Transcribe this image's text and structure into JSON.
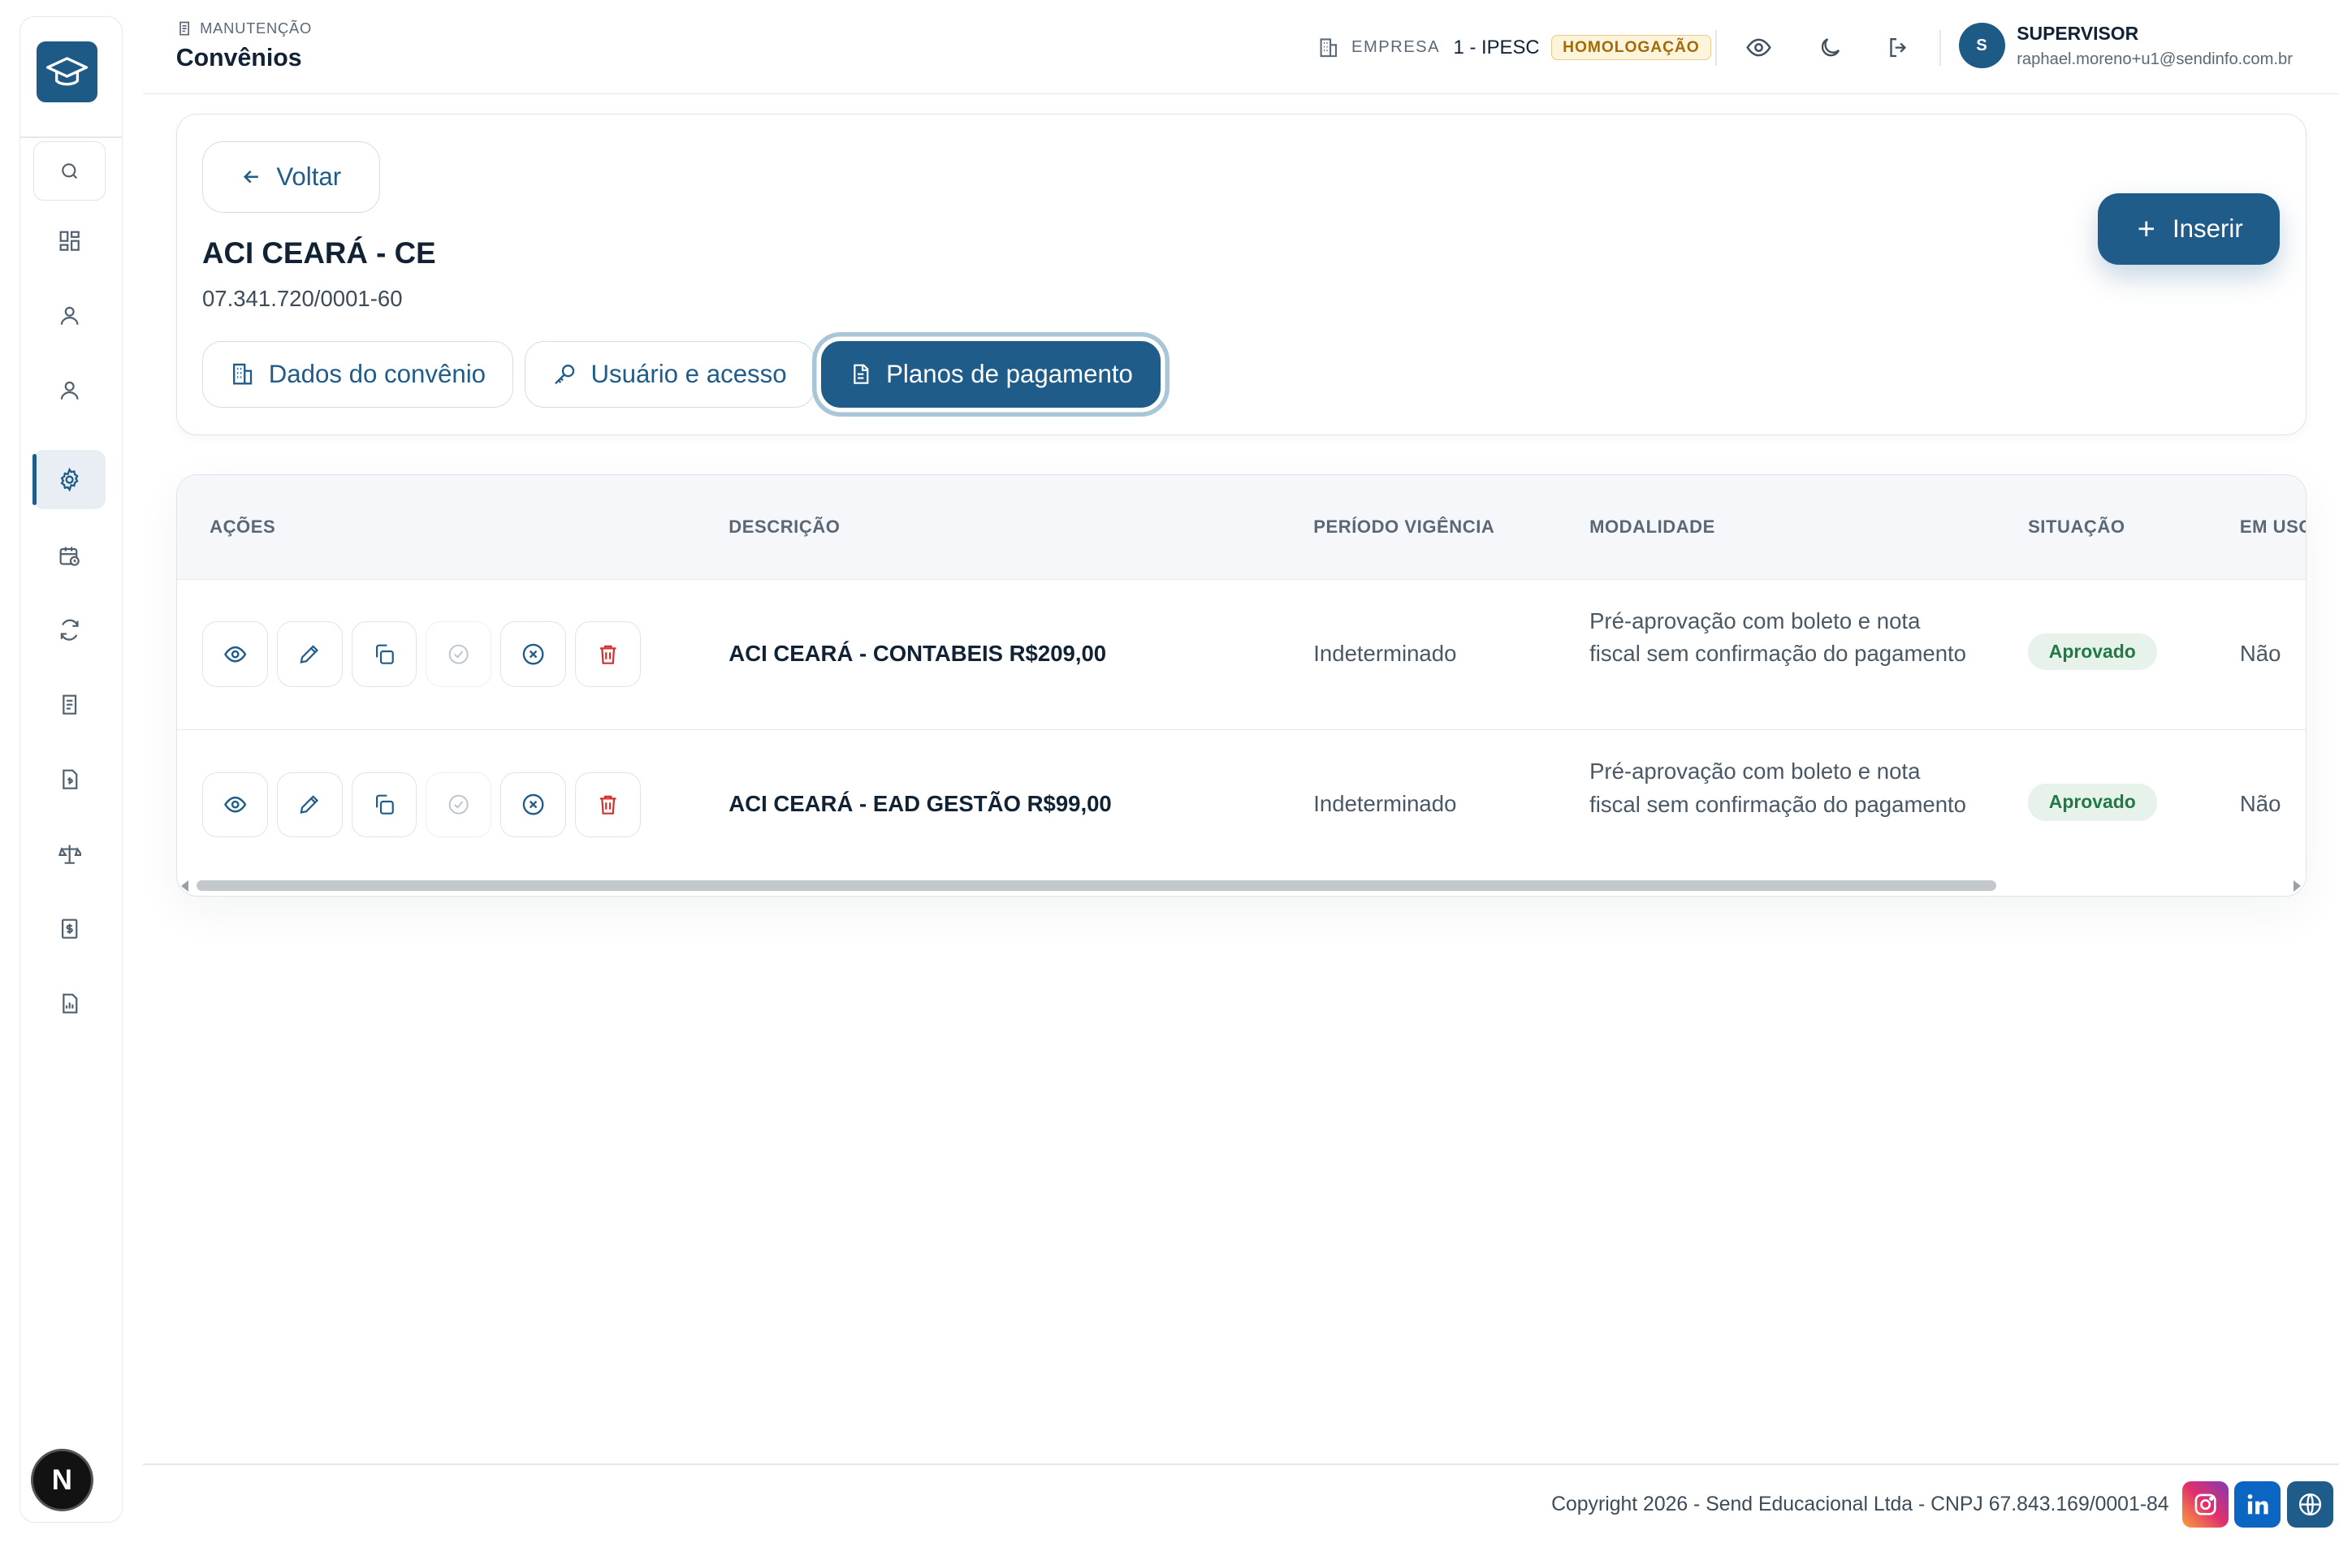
{
  "header": {
    "breadcrumb": "MANUTENÇÃO",
    "title": "Convênios",
    "company_label": "EMPRESA",
    "company_value": "1 - IPESC",
    "env_badge": "HOMOLOGAÇÃO",
    "user_name": "SUPERVISOR",
    "user_email": "raphael.moreno+u1@sendinfo.com.br",
    "avatar_initial": "S"
  },
  "sidebar": {
    "logo_icon": "graduation-cap-icon",
    "items": [
      {
        "icon": "search-icon"
      },
      {
        "icon": "dashboard-icon"
      },
      {
        "icon": "user-icon"
      },
      {
        "icon": "user-icon"
      },
      {
        "icon": "gear-icon",
        "active": true
      },
      {
        "icon": "calendar-clock-icon"
      },
      {
        "icon": "refresh-icon"
      },
      {
        "icon": "document-icon"
      },
      {
        "icon": "file-money-icon"
      },
      {
        "icon": "scale-icon"
      },
      {
        "icon": "dollar-receipt-icon"
      },
      {
        "icon": "report-chart-icon"
      }
    ],
    "bottom_badge": "N"
  },
  "convenio": {
    "back_label": "Voltar",
    "name": "ACI CEARÁ - CE",
    "cnpj": "07.341.720/0001-60",
    "insert_label": "Inserir",
    "tabs": [
      {
        "label": "Dados do convênio",
        "active": false
      },
      {
        "label": "Usuário e acesso",
        "active": false
      },
      {
        "label": "Planos de pagamento",
        "active": true
      }
    ]
  },
  "table": {
    "columns": [
      "AÇÕES",
      "DESCRIÇÃO",
      "PERÍODO VIGÊNCIA",
      "MODALIDADE",
      "SITUAÇÃO",
      "EM USO"
    ],
    "rows": [
      {
        "descricao": "ACI CEARÁ - CONTABEIS R$209,00",
        "periodo": "Indeterminado",
        "modalidade": "Pré-aprovação com boleto e nota fiscal sem confirmação do pagamento",
        "situacao": "Aprovado",
        "em_uso": "Não"
      },
      {
        "descricao": "ACI CEARÁ - EAD GESTÃO R$99,00",
        "periodo": "Indeterminado",
        "modalidade": "Pré-aprovação com boleto e nota fiscal sem confirmação do pagamento",
        "situacao": "Aprovado",
        "em_uso": "Não"
      }
    ]
  },
  "footer": {
    "copyright": "Copyright 2026 - Send Educacional Ltda - CNPJ 67.843.169/0001-84",
    "social": [
      "instagram-icon",
      "linkedin-icon",
      "globe-icon"
    ]
  },
  "colors": {
    "primary": "#1f5c8a",
    "approved_text": "#217a46",
    "approved_bg": "#e6f2ea",
    "env_badge_text": "#a46a08",
    "danger": "#d32f2f"
  }
}
